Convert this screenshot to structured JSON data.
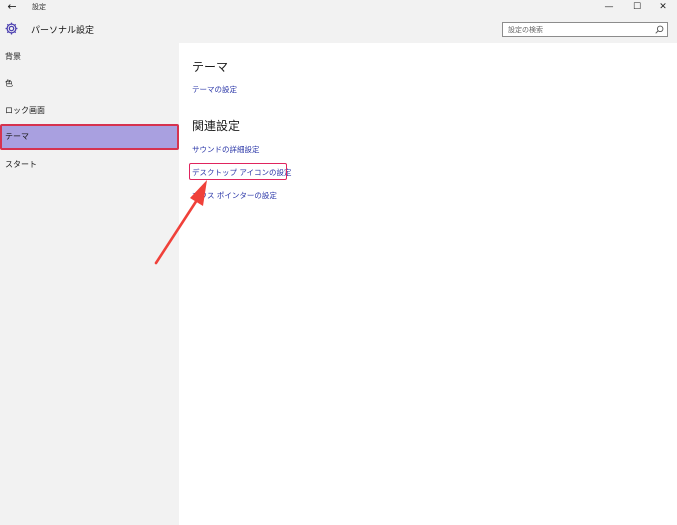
{
  "window": {
    "back_glyph": "←",
    "title": "設定",
    "minimize_glyph": "—",
    "maximize_glyph": "☐",
    "close_glyph": "✕"
  },
  "header": {
    "title": "パーソナル設定",
    "icon": "gear-icon"
  },
  "search": {
    "placeholder": "設定の検索",
    "icon": "search-icon"
  },
  "sidebar": {
    "items": [
      {
        "label": "背景",
        "selected": false
      },
      {
        "label": "色",
        "selected": false
      },
      {
        "label": "ロック画面",
        "selected": false
      },
      {
        "label": "テーマ",
        "selected": true
      },
      {
        "label": "スタート",
        "selected": false
      }
    ]
  },
  "main": {
    "theme_heading": "テーマ",
    "theme_settings_link": "テーマの設定",
    "related_heading": "関連設定",
    "related_links": [
      {
        "label": "サウンドの詳細設定"
      },
      {
        "label": "デスクトップ アイコンの設定",
        "highlighted": true
      },
      {
        "label": "マウス ポインターの設定"
      }
    ]
  },
  "annotation": {
    "arrow_color": "#f0413a",
    "highlight_color": "#e0245e"
  },
  "colors": {
    "selected_bg": "#a9a0e0",
    "link": "#2b37a8",
    "chrome_bg": "#f2f2f2"
  }
}
